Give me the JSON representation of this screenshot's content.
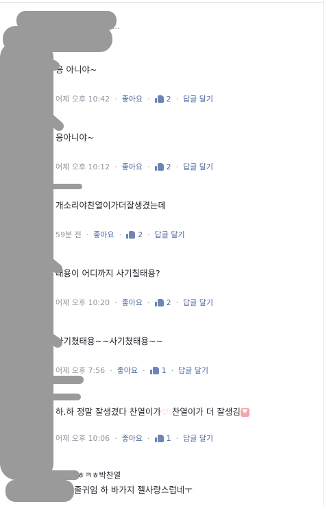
{
  "reply_hint": "답글 달기...",
  "comments": [
    {
      "name": "",
      "text": "응 아니야~",
      "time": "어제 오후 10:42",
      "like_label": "좋아요",
      "likes": "2",
      "reply_label": "답글 달기"
    },
    {
      "name": "",
      "text": "응아니야~",
      "time": "어제 오후 10:12",
      "like_label": "좋아요",
      "likes": "2",
      "reply_label": "답글 달기"
    },
    {
      "name": "",
      "text": "개소리야찬열이가더잘생겼는데",
      "time": "59분 전",
      "like_label": "좋아요",
      "likes": "2",
      "reply_label": "답글 달기"
    },
    {
      "name": "",
      "text": "태용이 어디까지 사기칠태용?",
      "time": "어제 오후 10:20",
      "like_label": "좋아요",
      "likes": "2",
      "reply_label": "답글 달기"
    },
    {
      "name": "",
      "text": "사기쳤태용~~사기쳤태용~~",
      "time": "어제 오후 7:56",
      "like_label": "좋아요",
      "likes": "1",
      "reply_label": "답글 달기"
    },
    {
      "name": "",
      "text_a": "하.하 정말 잘생겼다 찬열이가",
      "text_b": "찬열이가 더 잘생김",
      "time": "어제 오후 10:06",
      "like_label": "좋아요",
      "likes": "1",
      "reply_label": "답글 달기"
    },
    {
      "name": "ㅋㅎㅋㅎㅋㅎ박찬열",
      "text": "진짜 졸귀임 하 바가지 젤사랑스럽네ㅜ"
    }
  ],
  "colors": {
    "link": "#4b67a1",
    "meta": "#90949c",
    "text": "#1d2129",
    "like_icon": "#6d84b4",
    "redaction": "#9a9a9a"
  },
  "icons": [
    "like-icon",
    "heart-icon"
  ]
}
